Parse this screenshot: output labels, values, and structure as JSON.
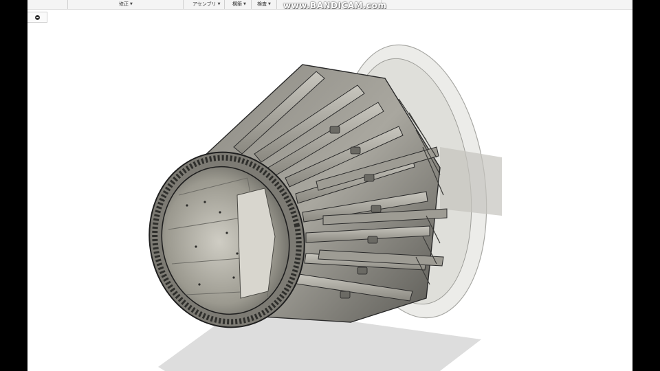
{
  "toolbar": {
    "menus": [
      {
        "label": "修正"
      },
      {
        "label": "アセンブリ"
      },
      {
        "label": "構築"
      },
      {
        "label": "検査"
      }
    ]
  },
  "watermark": {
    "text": "www.BANDICAM.com"
  },
  "colors": {
    "background": "#ffffff",
    "toolbar": "#f4f4f4",
    "metal_light": "#a9a79f",
    "metal_dark": "#4f4e4a",
    "edge": "#2a2a2a",
    "ghost_shell": "#cfcfca"
  },
  "icons": {
    "nav_chip": "minus-circle-icon",
    "menu_caret": "caret-down-icon"
  }
}
